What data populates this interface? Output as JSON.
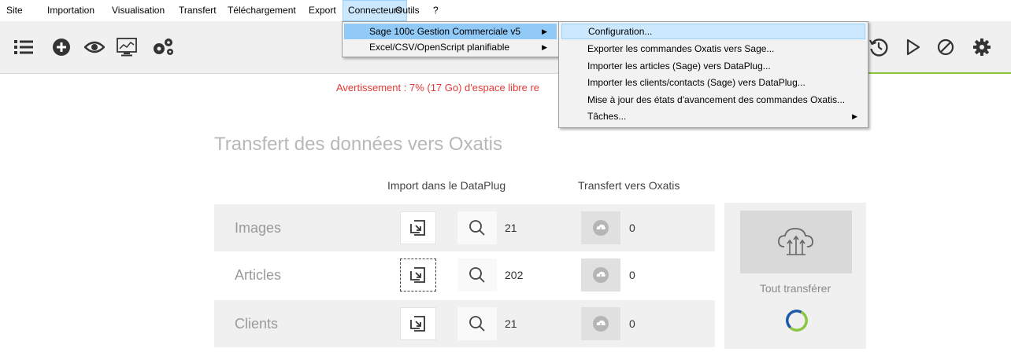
{
  "menubar": {
    "items": [
      "Site",
      "Importation",
      "Visualisation",
      "Transfert",
      "Téléchargement",
      "Export",
      "Connecteurs",
      "Outils",
      "?"
    ]
  },
  "toolbar": {
    "left_icons": [
      "list-icon",
      "add-circle-icon",
      "eye-icon",
      "monitor-chart-icon",
      "gears-icon"
    ],
    "right_icons": [
      "history-icon",
      "play-icon",
      "cancel-icon",
      "gear-icon"
    ]
  },
  "connecteurs_menu": {
    "items": [
      {
        "label": "Sage 100c Gestion Commerciale v5",
        "has_submenu": true
      },
      {
        "label": "Excel/CSV/OpenScript planifiable",
        "has_submenu": true
      }
    ]
  },
  "sage_submenu": {
    "items": [
      {
        "label": "Configuration...",
        "has_submenu": false
      },
      {
        "label": "Exporter les commandes Oxatis vers Sage...",
        "has_submenu": false
      },
      {
        "label": "Importer les articles (Sage) vers DataPlug...",
        "has_submenu": false
      },
      {
        "label": "Importer les clients/contacts (Sage) vers DataPlug...",
        "has_submenu": false
      },
      {
        "label": "Mise à jour des états d'avancement des commandes Oxatis...",
        "has_submenu": false
      },
      {
        "label": "Tâches...",
        "has_submenu": true
      }
    ]
  },
  "main": {
    "warning": "Avertissement : 7% (17 Go) d'espace libre re",
    "title": "Transfert des données vers Oxatis",
    "col_import": "Import dans le DataPlug",
    "col_transfer": "Transfert vers Oxatis",
    "rows": [
      {
        "label": "Images",
        "import_count": "21",
        "transfer_count": "0"
      },
      {
        "label": "Articles",
        "import_count": "202",
        "transfer_count": "0"
      },
      {
        "label": "Clients",
        "import_count": "21",
        "transfer_count": "0"
      }
    ],
    "transfer_all_label": "Tout transférer"
  },
  "colors": {
    "warning": "#e53935",
    "accent_green": "#8cc63f",
    "menu_highlight": "#91c9f7"
  }
}
